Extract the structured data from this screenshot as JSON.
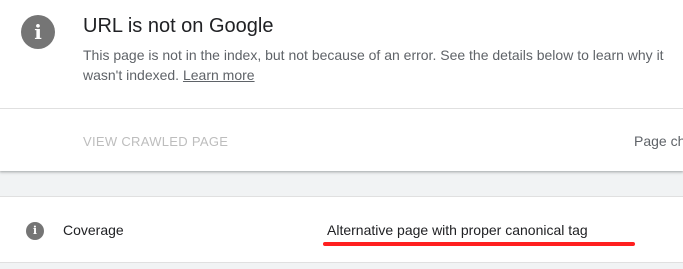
{
  "header": {
    "icon": "info-icon",
    "title": "URL is not on Google",
    "description": "This page is not in the index, but not because of an error. See the details below to learn why it wasn't indexed.",
    "learn_more_label": "Learn more"
  },
  "actions": {
    "view_crawled_label": "VIEW CRAWLED PAGE",
    "page_changes_label": "Page ch"
  },
  "coverage_row": {
    "icon": "info-icon",
    "label": "Coverage",
    "value": "Alternative page with proper canonical tag",
    "highlight_color": "#ff1f1f"
  },
  "colors": {
    "background": "#f1f3f4",
    "card": "#ffffff",
    "icon": "#757575",
    "disabled_text": "#bdbdbd"
  }
}
